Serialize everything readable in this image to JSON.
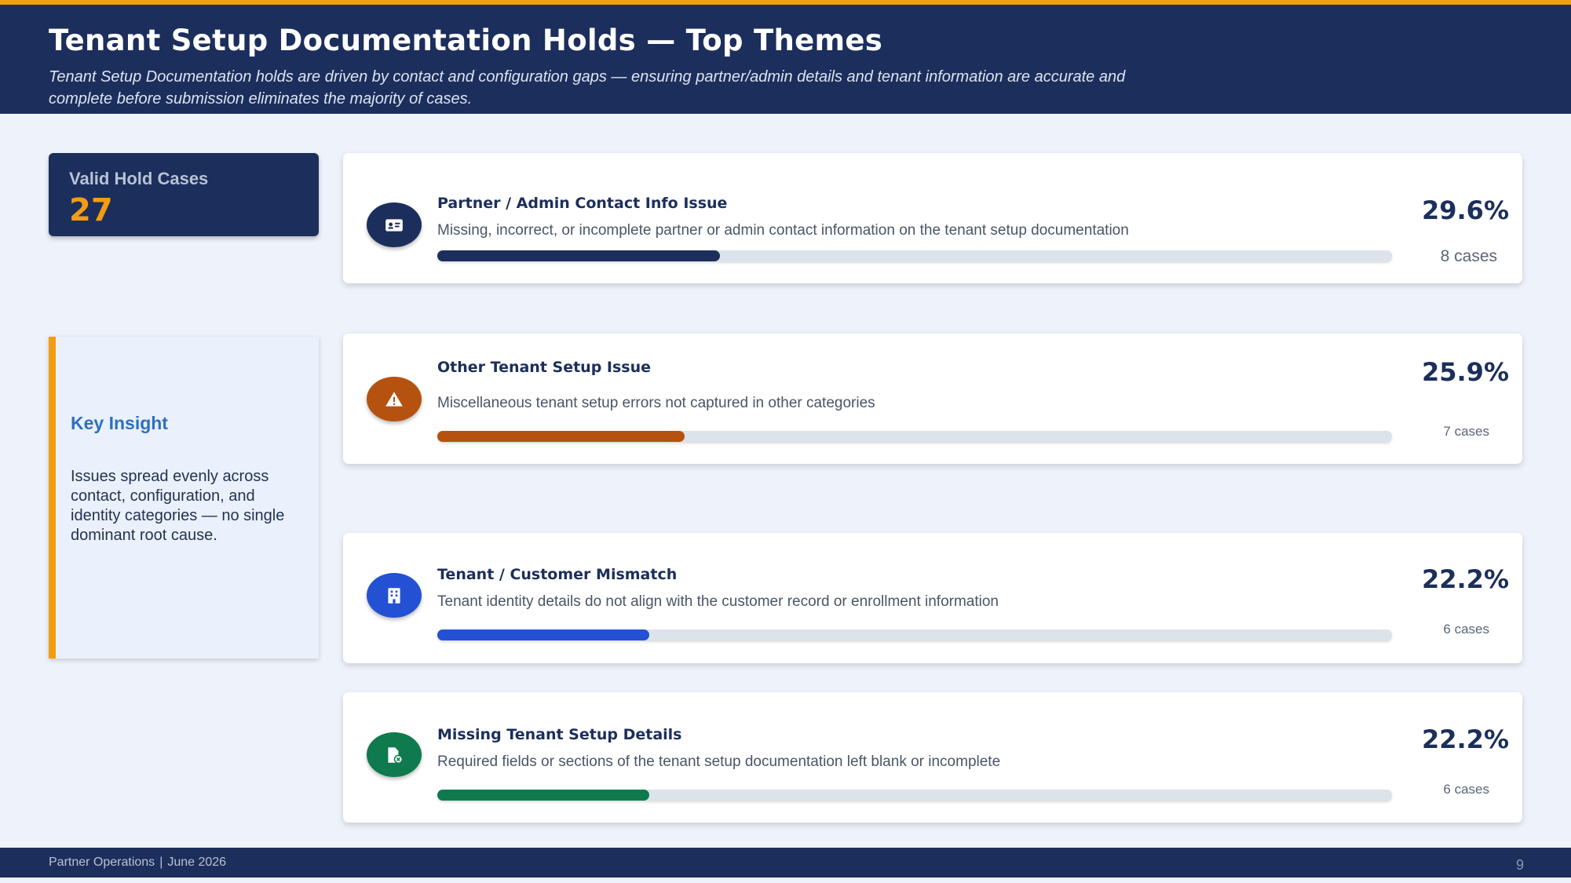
{
  "header": {
    "title": "Tenant Setup Documentation Holds — Top Themes",
    "subtitle": "Tenant Setup Documentation holds are driven by contact and configuration gaps — ensuring partner/admin details and tenant information are accurate and complete before submission eliminates the majority of cases."
  },
  "stat": {
    "label": "Valid Hold Cases",
    "value": "27"
  },
  "insight": {
    "title": "Key Insight",
    "body": "Issues spread evenly across contact, configuration, and identity categories — no single dominant root cause."
  },
  "themes": [
    {
      "title": "Partner / Admin Contact Info Issue",
      "description": "Missing, incorrect, or incomplete partner or admin contact information on the tenant setup documentation",
      "percent_label": "29.6%",
      "percent": 29.6,
      "cases_label": "8 cases",
      "color": "#1C2E5C",
      "icon": "id-card-icon"
    },
    {
      "title": "Other Tenant Setup Issue",
      "description": "Miscellaneous tenant setup errors not captured in other categories",
      "percent_label": "25.9%",
      "percent": 25.9,
      "cases_label": "7 cases",
      "color": "#B5520F",
      "icon": "warning-icon"
    },
    {
      "title": "Tenant / Customer Mismatch",
      "description": "Tenant identity details do not align with the customer record or enrollment information",
      "percent_label": "22.2%",
      "percent": 22.2,
      "cases_label": "6 cases",
      "color": "#2450D4",
      "icon": "building-icon"
    },
    {
      "title": "Missing Tenant Setup Details",
      "description": "Required fields or sections of the tenant setup documentation left blank or incomplete",
      "percent_label": "22.2%",
      "percent": 22.2,
      "cases_label": "6 cases",
      "color": "#0E7A4E",
      "icon": "file-missing-icon"
    }
  ],
  "footer": {
    "org": "Partner Operations",
    "separator": "|",
    "date": "June 2026",
    "page": "9"
  }
}
